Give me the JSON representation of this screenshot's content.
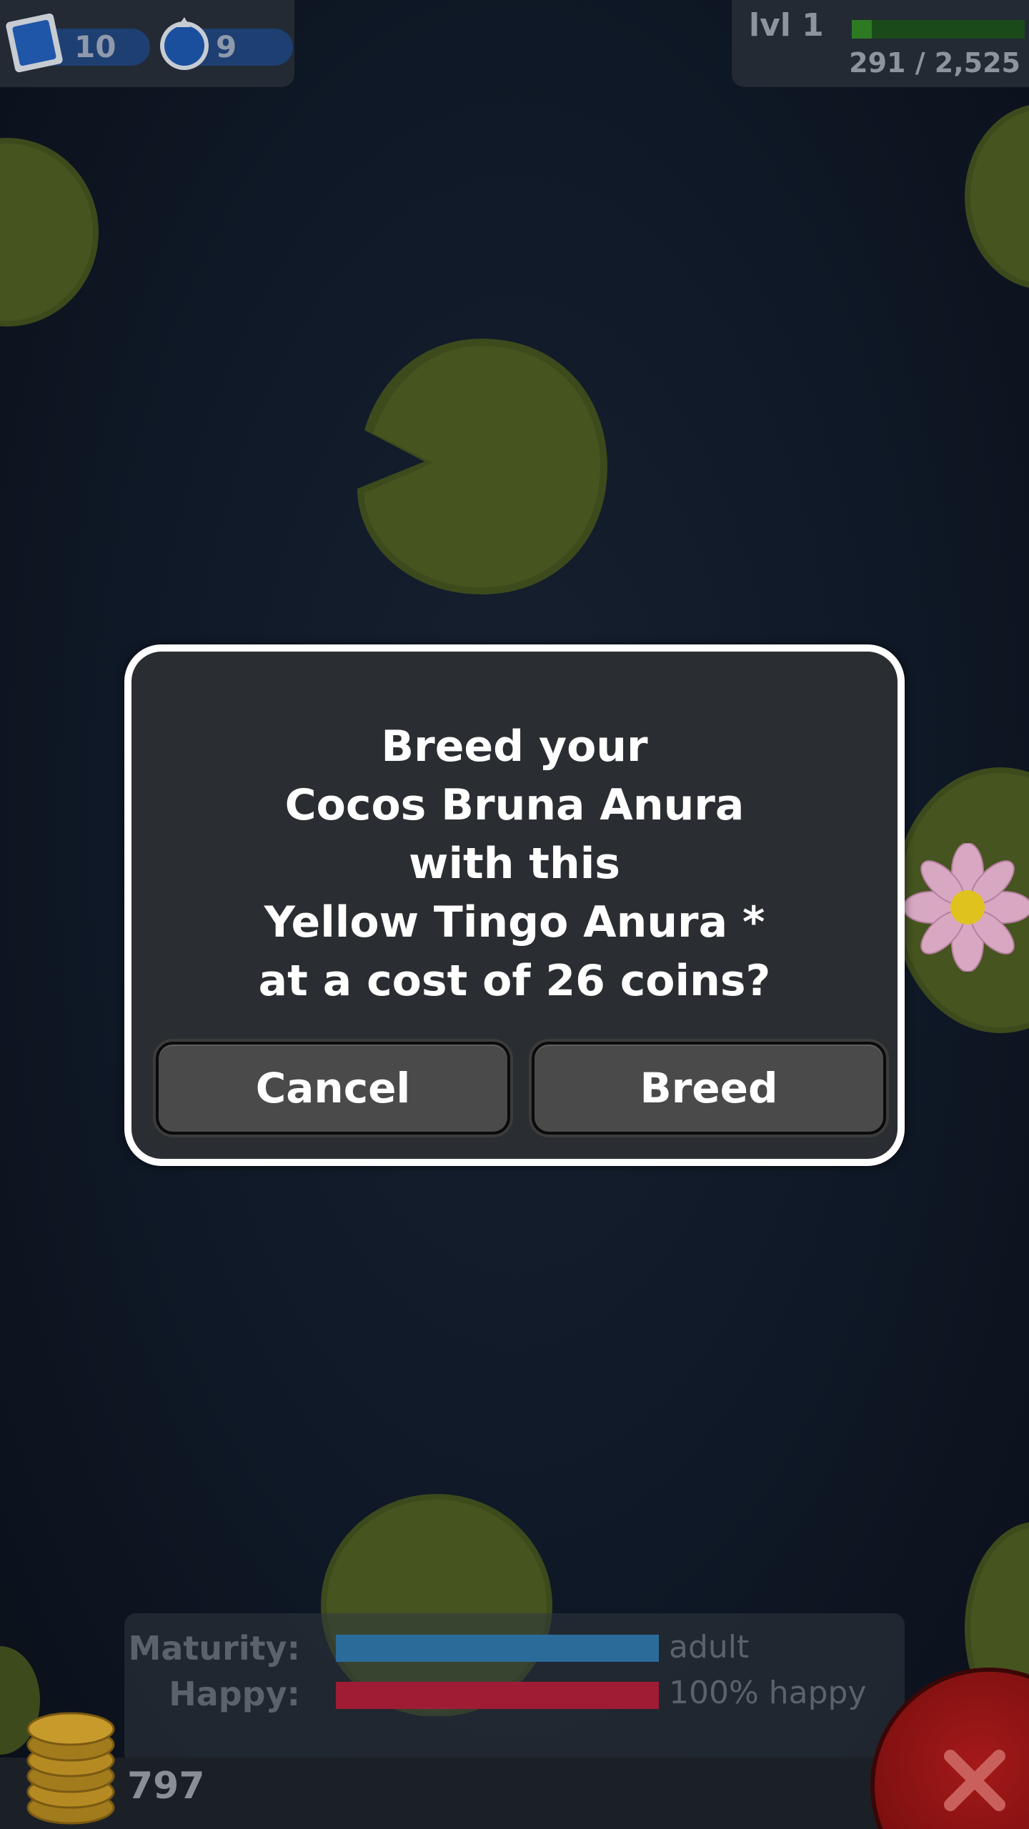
{
  "hud": {
    "stamps_count": "10",
    "gems_count": "9",
    "level_label": "lvl 1",
    "xp_text": "291 / 2,525",
    "xp_progress": 0.115
  },
  "dialog": {
    "message_lines": [
      "Breed your",
      "Cocos Bruna Anura",
      "with this",
      "Yellow Tingo Anura *",
      "at a cost of 26 coins?"
    ],
    "cancel_label": "Cancel",
    "confirm_label": "Breed"
  },
  "stats": {
    "maturity_label": "Maturity:",
    "maturity_value": "adult",
    "maturity_progress": 1.0,
    "happy_label": "Happy:",
    "happy_value": "100% happy",
    "happy_progress": 1.0
  },
  "footer": {
    "coins": "797"
  },
  "icons": {
    "stamp": "stamp-icon",
    "gem": "gem-icon",
    "coins": "coin-stack-icon",
    "close": "close-icon",
    "flower": "water-lily-flower-icon"
  },
  "colors": {
    "dialog_bg": "#2a2d31",
    "dialog_border": "#ffffff",
    "maturity_bar": "#2b6b9a",
    "happy_bar": "#a01c34",
    "xp_bar": "#2d7a22",
    "close_button": "#a51919"
  }
}
